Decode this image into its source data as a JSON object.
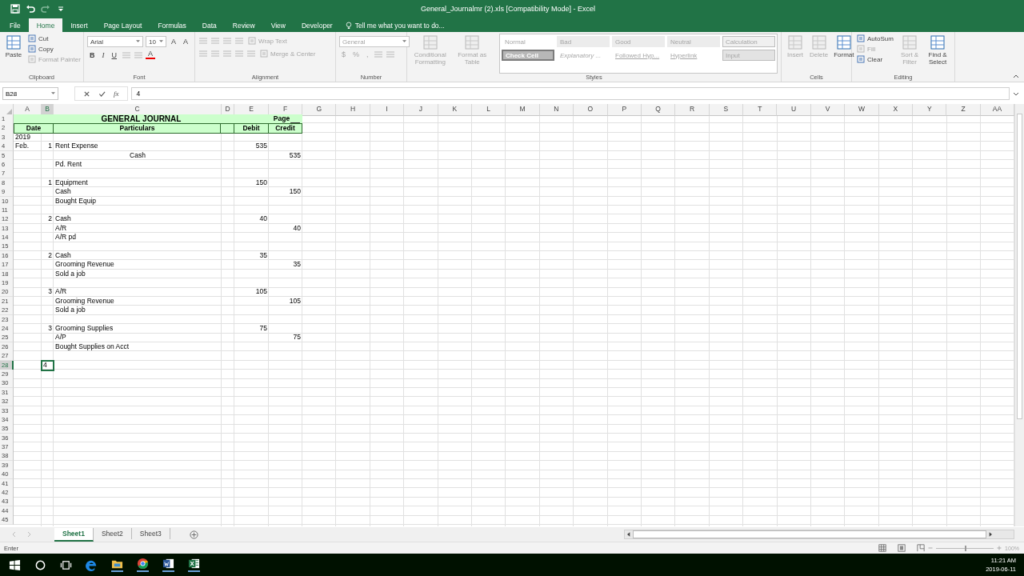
{
  "window": {
    "title": "General_Journalmr (2).xls  [Compatibility Mode] - Excel"
  },
  "ribbon_tabs": [
    {
      "label": "File",
      "selected": false
    },
    {
      "label": "Home",
      "selected": true
    },
    {
      "label": "Insert",
      "selected": false
    },
    {
      "label": "Page Layout",
      "selected": false
    },
    {
      "label": "Formulas",
      "selected": false
    },
    {
      "label": "Data",
      "selected": false
    },
    {
      "label": "Review",
      "selected": false
    },
    {
      "label": "View",
      "selected": false
    },
    {
      "label": "Developer",
      "selected": false
    }
  ],
  "tell_me": "Tell me what you want to do...",
  "ribbon_groups": [
    {
      "label": "Clipboard",
      "columns": [
        [
          [
            {
              "kind": "large",
              "label": "Paste",
              "disabled": false
            }
          ]
        ],
        [
          [
            {
              "kind": "small",
              "label": "Cut",
              "disabled": false
            }
          ],
          [
            {
              "kind": "small",
              "label": "Copy",
              "disabled": false
            }
          ],
          [
            {
              "kind": "small",
              "label": "Format Painter",
              "disabled": true
            }
          ]
        ]
      ]
    },
    {
      "label": "Font",
      "columns": [
        [
          [
            {
              "kind": "font-field",
              "label": "Arial",
              "disabled": false
            },
            {
              "kind": "size-field",
              "label": "10",
              "disabled": false
            },
            {
              "kind": "glyph",
              "label": "A",
              "disabled": false
            },
            {
              "kind": "glyph",
              "label": "A",
              "disabled": false
            }
          ],
          [
            {
              "kind": "bold",
              "label": "B",
              "disabled": false
            },
            {
              "kind": "italic",
              "label": "I",
              "disabled": false
            },
            {
              "kind": "underline",
              "label": "U",
              "disabled": false
            },
            {
              "kind": "icon",
              "disabled": true
            },
            {
              "kind": "icon",
              "disabled": true
            },
            {
              "kind": "color-glyph",
              "label": "A",
              "disabled": false
            }
          ]
        ]
      ]
    },
    {
      "label": "Alignment",
      "columns": [
        [
          [
            {
              "kind": "icon",
              "disabled": true
            },
            {
              "kind": "icon",
              "disabled": true
            },
            {
              "kind": "icon",
              "disabled": true
            },
            {
              "kind": "icon",
              "disabled": true
            },
            {
              "kind": "small",
              "label": "Wrap Text",
              "disabled": true
            }
          ],
          [
            {
              "kind": "icon",
              "disabled": true
            },
            {
              "kind": "icon",
              "disabled": true
            },
            {
              "kind": "icon",
              "disabled": true
            },
            {
              "kind": "icon",
              "disabled": true
            },
            {
              "kind": "icon",
              "disabled": true
            },
            {
              "kind": "small",
              "label": "Merge & Center",
              "disabled": true
            }
          ]
        ]
      ]
    },
    {
      "label": "Number",
      "columns": [
        [
          [
            {
              "kind": "format-field",
              "label": "General",
              "disabled": true
            }
          ],
          [
            {
              "kind": "glyph",
              "label": "$",
              "disabled": true
            },
            {
              "kind": "glyph",
              "label": "%",
              "disabled": true
            },
            {
              "kind": "glyph",
              "label": ",",
              "disabled": true
            },
            {
              "kind": "icon",
              "disabled": true
            },
            {
              "kind": "icon",
              "disabled": true
            }
          ]
        ]
      ]
    },
    {
      "label": "Styles",
      "columns": [
        [
          [
            {
              "kind": "large",
              "label": "Conditional Formatting",
              "disabled": true
            }
          ]
        ],
        [
          [
            {
              "kind": "large",
              "label": "Format as Table",
              "disabled": true
            }
          ]
        ],
        [
          [
            {
              "kind": "style",
              "label": "Normal",
              "disabled": true
            },
            {
              "kind": "style",
              "label": "Bad",
              "disabled": true
            },
            {
              "kind": "style",
              "label": "Good",
              "disabled": true
            },
            {
              "kind": "style",
              "label": "Neutral",
              "disabled": true
            },
            {
              "kind": "style",
              "label": "Calculation",
              "disabled": true
            }
          ],
          [
            {
              "kind": "style",
              "label": "Check Cell",
              "disabled": true
            },
            {
              "kind": "style",
              "label": "Explanatory ...",
              "disabled": true
            },
            {
              "kind": "style",
              "label": "Followed Hyp...",
              "disabled": true
            },
            {
              "kind": "style",
              "label": "Hyperlink",
              "disabled": true
            },
            {
              "kind": "style",
              "label": "Input",
              "disabled": true
            }
          ]
        ]
      ]
    },
    {
      "label": "Cells",
      "columns": [
        [
          [
            {
              "kind": "large",
              "label": "Insert",
              "disabled": true
            }
          ]
        ],
        [
          [
            {
              "kind": "large",
              "label": "Delete",
              "disabled": true
            }
          ]
        ],
        [
          [
            {
              "kind": "large",
              "label": "Format",
              "disabled": false
            }
          ]
        ]
      ]
    },
    {
      "label": "Editing",
      "columns": [
        [
          [
            {
              "kind": "small",
              "label": "AutoSum",
              "disabled": false
            }
          ],
          [
            {
              "kind": "small",
              "label": "Fill",
              "disabled": true
            }
          ],
          [
            {
              "kind": "small",
              "label": "Clear",
              "disabled": false
            }
          ]
        ],
        [
          [
            {
              "kind": "large",
              "label": "Sort & Filter",
              "disabled": true
            }
          ]
        ],
        [
          [
            {
              "kind": "large",
              "label": "Find & Select",
              "disabled": false
            }
          ]
        ]
      ]
    }
  ],
  "name_box": "B28",
  "function_label": "fx",
  "formula": "4",
  "columns": [
    {
      "label": "A",
      "selected": false
    },
    {
      "label": "B",
      "selected": true
    },
    {
      "label": "C",
      "selected": false
    },
    {
      "label": "D",
      "selected": false
    },
    {
      "label": "E",
      "selected": false
    },
    {
      "label": "F",
      "selected": false
    },
    {
      "label": "G",
      "selected": false
    },
    {
      "label": "H",
      "selected": false
    },
    {
      "label": "I",
      "selected": false
    },
    {
      "label": "J",
      "selected": false
    },
    {
      "label": "K",
      "selected": false
    },
    {
      "label": "L",
      "selected": false
    },
    {
      "label": "M",
      "selected": false
    },
    {
      "label": "N",
      "selected": false
    },
    {
      "label": "O",
      "selected": false
    },
    {
      "label": "P",
      "selected": false
    },
    {
      "label": "Q",
      "selected": false
    },
    {
      "label": "R",
      "selected": false
    },
    {
      "label": "S",
      "selected": false
    },
    {
      "label": "T",
      "selected": false
    },
    {
      "label": "U",
      "selected": false
    },
    {
      "label": "V",
      "selected": false
    },
    {
      "label": "W",
      "selected": false
    },
    {
      "label": "X",
      "selected": false
    },
    {
      "label": "Y",
      "selected": false
    },
    {
      "label": "Z",
      "selected": false
    },
    {
      "label": "AA",
      "selected": false
    }
  ],
  "rows": [
    {
      "number": "1",
      "selected": false,
      "kind": "title",
      "title": "GENERAL JOURNAL",
      "page": "Page"
    },
    {
      "number": "2",
      "selected": false,
      "kind": "header",
      "labels": [
        "Date",
        "Particulars",
        "Debit",
        "Credit"
      ]
    },
    {
      "number": "3",
      "selected": false,
      "kind": "entry",
      "date": "2019"
    },
    {
      "number": "4",
      "selected": false,
      "kind": "entry",
      "date": "Feb.",
      "day": "1",
      "particulars": "Rent Expense",
      "debit": "535"
    },
    {
      "number": "5",
      "selected": false,
      "kind": "centered-entry",
      "particulars": "Cash",
      "credit": "535"
    },
    {
      "number": "6",
      "selected": false,
      "kind": "entry",
      "particulars": "Pd. Rent"
    },
    {
      "number": "7",
      "selected": false,
      "kind": "entry"
    },
    {
      "number": "8",
      "selected": false,
      "kind": "entry",
      "day": "1",
      "particulars": "Equipment",
      "debit": "150"
    },
    {
      "number": "9",
      "selected": false,
      "kind": "entry",
      "particulars": "Cash",
      "credit": "150"
    },
    {
      "number": "10",
      "selected": false,
      "kind": "entry",
      "particulars": "Bought Equip"
    },
    {
      "number": "11",
      "selected": false,
      "kind": "entry"
    },
    {
      "number": "12",
      "selected": false,
      "kind": "entry",
      "day": "2",
      "particulars": "Cash",
      "debit": "40"
    },
    {
      "number": "13",
      "selected": false,
      "kind": "entry",
      "particulars": "A/R",
      "credit": "40"
    },
    {
      "number": "14",
      "selected": false,
      "kind": "entry",
      "particulars": "A/R pd"
    },
    {
      "number": "15",
      "selected": false,
      "kind": "entry"
    },
    {
      "number": "16",
      "selected": false,
      "kind": "entry",
      "day": "2",
      "particulars": "Cash",
      "debit": "35"
    },
    {
      "number": "17",
      "selected": false,
      "kind": "entry",
      "particulars": "Grooming Revenue",
      "credit": "35"
    },
    {
      "number": "18",
      "selected": false,
      "kind": "entry",
      "particulars": "Sold a job"
    },
    {
      "number": "19",
      "selected": false,
      "kind": "entry"
    },
    {
      "number": "20",
      "selected": false,
      "kind": "entry",
      "day": "3",
      "particulars": "A/R",
      "debit": "105"
    },
    {
      "number": "21",
      "selected": false,
      "kind": "entry",
      "particulars": "Grooming Revenue",
      "credit": "105"
    },
    {
      "number": "22",
      "selected": false,
      "kind": "entry",
      "particulars": "Sold a job"
    },
    {
      "number": "23",
      "selected": false,
      "kind": "entry"
    },
    {
      "number": "24",
      "selected": false,
      "kind": "entry",
      "day": "3",
      "particulars": "Grooming Supplies",
      "debit": "75"
    },
    {
      "number": "25",
      "selected": false,
      "kind": "entry",
      "particulars": "A/P",
      "credit": "75"
    },
    {
      "number": "26",
      "selected": false,
      "kind": "entry",
      "particulars": "Bought Supplies on Acct"
    },
    {
      "number": "27",
      "selected": false,
      "kind": "entry"
    },
    {
      "number": "28",
      "selected": true,
      "kind": "editing",
      "day": "4"
    },
    {
      "number": "29",
      "selected": false,
      "kind": "entry"
    },
    {
      "number": "30",
      "selected": false,
      "kind": "entry"
    },
    {
      "number": "31",
      "selected": false,
      "kind": "entry"
    },
    {
      "number": "32",
      "selected": false,
      "kind": "entry"
    },
    {
      "number": "33",
      "selected": false,
      "kind": "entry"
    },
    {
      "number": "34",
      "selected": false,
      "kind": "entry"
    },
    {
      "number": "35",
      "selected": false,
      "kind": "entry"
    },
    {
      "number": "36",
      "selected": false,
      "kind": "entry"
    },
    {
      "number": "37",
      "selected": false,
      "kind": "entry"
    },
    {
      "number": "38",
      "selected": false,
      "kind": "entry"
    },
    {
      "number": "39",
      "selected": false,
      "kind": "entry"
    },
    {
      "number": "40",
      "selected": false,
      "kind": "entry"
    },
    {
      "number": "41",
      "selected": false,
      "kind": "entry"
    },
    {
      "number": "42",
      "selected": false,
      "kind": "entry"
    },
    {
      "number": "43",
      "selected": false,
      "kind": "entry"
    },
    {
      "number": "44",
      "selected": false,
      "kind": "entry"
    },
    {
      "number": "45",
      "selected": false,
      "kind": "entry"
    }
  ],
  "sheets": [
    {
      "label": "Sheet1",
      "selected": true
    },
    {
      "label": "Sheet2",
      "selected": false
    },
    {
      "label": "Sheet3",
      "selected": false
    }
  ],
  "status": "Enter",
  "zoom": {
    "level": 0.5,
    "reading": "100%"
  },
  "clock": {
    "time": "11:21 AM",
    "date": "2019-06-11"
  }
}
